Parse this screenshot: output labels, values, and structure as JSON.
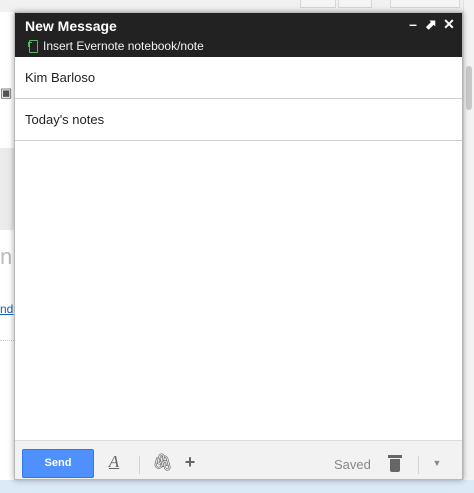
{
  "background": {
    "left_link_text": "nd",
    "left_partial_glyph": "n"
  },
  "compose": {
    "title": "New Message",
    "evernote_label": "Insert Evernote notebook/note",
    "window_controls": {
      "minimize": "–",
      "popout": "⬈",
      "close": "✕"
    },
    "to_value": "Kim Barloso",
    "subject_value": "Today's notes",
    "body_text": "",
    "toolbar": {
      "send_label": "Send",
      "format_glyph": "A",
      "attach_glyph": "🖇",
      "more_options_glyph": "+",
      "saved_label": "Saved",
      "dropdown_glyph": "▼"
    }
  },
  "colors": {
    "titlebar": "#222222",
    "send_button": "#4d90fe",
    "evernote_green": "#5cb85c"
  }
}
